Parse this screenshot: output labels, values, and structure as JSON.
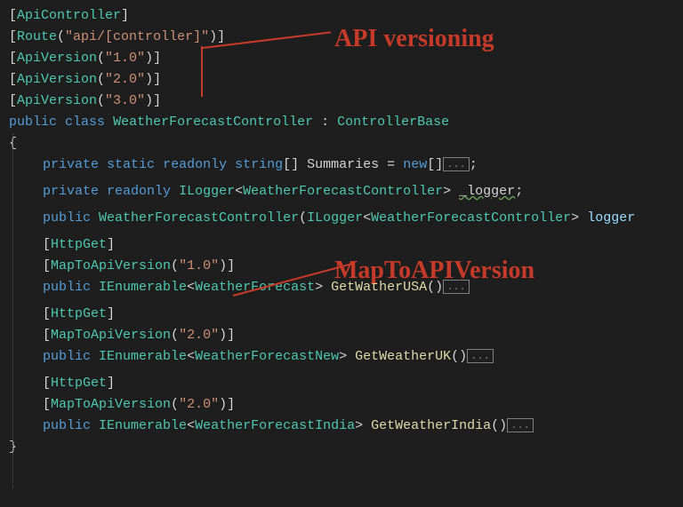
{
  "annotations": {
    "api_versioning": "API versioning",
    "map_to_api_version": "MapToAPIVersion"
  },
  "code": {
    "attr_api_controller": "ApiController",
    "attr_route_name": "Route",
    "route_value": "\"api/[controller]\"",
    "attr_api_version": "ApiVersion",
    "ver1": "\"1.0\"",
    "ver2": "\"2.0\"",
    "ver3": "\"3.0\"",
    "kw_public": "public",
    "kw_class": "class",
    "kw_private": "private",
    "kw_static": "static",
    "kw_readonly": "readonly",
    "kw_new": "new",
    "kw_string": "string",
    "class_name": "WeatherForecastController",
    "base_class": "ControllerBase",
    "summaries_field": "Summaries",
    "ilogger": "ILogger",
    "logger_field": "_logger",
    "logger_param": "logger",
    "http_get": "HttpGet",
    "map_to_api_version": "MapToApiVersion",
    "ienumerable": "IEnumerable",
    "weather_forecast": "WeatherForecast",
    "weather_forecast_new": "WeatherForecastNew",
    "weather_forecast_india": "WeatherForecastIndia",
    "method_usa": "GetWatherUSA",
    "method_uk": "GetWeatherUK",
    "method_india": "GetWeatherIndia",
    "collapsed": "..."
  }
}
